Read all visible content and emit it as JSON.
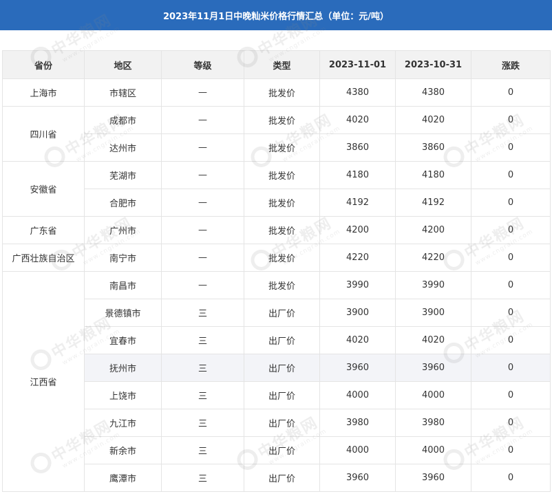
{
  "title": "2023年11月1日中晚籼米价格行情汇总（单位：元/吨）",
  "headers": [
    "省份",
    "地区",
    "等级",
    "类型",
    "2023-11-01",
    "2023-10-31",
    "涨跌"
  ],
  "provinces": [
    "上海市",
    "四川省",
    "安徽省",
    "广东省",
    "广西壮族自治区",
    "江西省"
  ],
  "rows": [
    [
      "市辖区",
      "—",
      "批发价",
      "4380",
      "4380",
      "0"
    ],
    [
      "成都市",
      "—",
      "批发价",
      "4020",
      "4020",
      "0"
    ],
    [
      "达州市",
      "—",
      "批发价",
      "3860",
      "3860",
      "0"
    ],
    [
      "芜湖市",
      "—",
      "批发价",
      "4180",
      "4180",
      "0"
    ],
    [
      "合肥市",
      "—",
      "批发价",
      "4192",
      "4192",
      "0"
    ],
    [
      "广州市",
      "—",
      "批发价",
      "4200",
      "4200",
      "0"
    ],
    [
      "南宁市",
      "—",
      "批发价",
      "4220",
      "4220",
      "0"
    ],
    [
      "南昌市",
      "—",
      "批发价",
      "3990",
      "3990",
      "0"
    ],
    [
      "景德镇市",
      "三",
      "出厂价",
      "3900",
      "3900",
      "0"
    ],
    [
      "宜春市",
      "三",
      "出厂价",
      "4020",
      "4020",
      "0"
    ],
    [
      "抚州市",
      "三",
      "出厂价",
      "3960",
      "3960",
      "0"
    ],
    [
      "上饶市",
      "三",
      "出厂价",
      "4000",
      "4000",
      "0"
    ],
    [
      "九江市",
      "三",
      "出厂价",
      "3980",
      "3980",
      "0"
    ],
    [
      "新余市",
      "三",
      "出厂价",
      "4000",
      "4000",
      "0"
    ],
    [
      "鹰潭市",
      "三",
      "出厂价",
      "3960",
      "3960",
      "0"
    ]
  ],
  "watermark": {
    "text": "中华粮网",
    "site": "www.cngrain.com"
  }
}
